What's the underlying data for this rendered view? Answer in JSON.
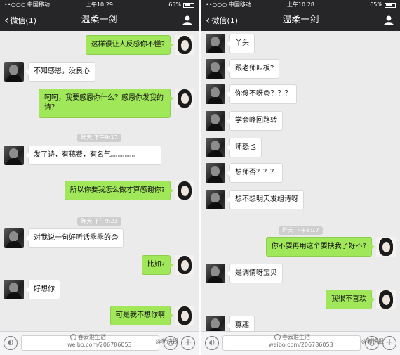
{
  "left": {
    "status": {
      "carrier": "••○○○ 中国移动",
      "time": "上午10:29",
      "battery": "65%"
    },
    "nav": {
      "back_label": "微信(1)",
      "title": "温柔一剑"
    },
    "messages": [
      {
        "dir": "out",
        "text": "这样很让人反感你不懂?"
      },
      {
        "dir": "in",
        "text": "不知感恩，没良心"
      },
      {
        "dir": "out",
        "text": "呵呵，我要感恩你什么？感恩你发我的诗？"
      },
      {
        "dir": "in",
        "text": "发了诗，有稿费，有名气。。。。。。。"
      },
      {
        "dir": "out",
        "text": "所以你要我怎么做才算感谢你?"
      },
      {
        "dir": "in",
        "text": "对我说一句好听话乖乖的😊"
      },
      {
        "dir": "out",
        "text": "比如?"
      },
      {
        "dir": "in",
        "text": "好想你"
      },
      {
        "dir": "out",
        "text": "可是我不想你啊"
      }
    ],
    "timestamps": [
      "昨天 下午9:17",
      "昨天 下午9:23"
    ],
    "watermark": {
      "line1": "春云港生活",
      "line2": "weibo.com/2067860​53",
      "brand": "@新快报"
    }
  },
  "right": {
    "status": {
      "carrier": "••○○○ 中国移动",
      "time": "上午10:28",
      "battery": "65%"
    },
    "nav": {
      "back_label": "微信(1)",
      "title": "温柔一剑"
    },
    "messages": [
      {
        "dir": "in",
        "text": "丫头"
      },
      {
        "dir": "in",
        "text": "跟老师叫板?"
      },
      {
        "dir": "in",
        "text": "你傻不呀😊？？？"
      },
      {
        "dir": "in",
        "text": "学会峰回路转"
      },
      {
        "dir": "in",
        "text": "师怒也"
      },
      {
        "dir": "in",
        "text": "想师否？？？"
      },
      {
        "dir": "in",
        "text": "想不想明天发组诗呀"
      },
      {
        "dir": "out",
        "text": "你不要再用这个要挟我了好不?"
      },
      {
        "dir": "in",
        "text": "是调情呀宝贝"
      },
      {
        "dir": "out",
        "text": "我很不喜欢"
      },
      {
        "dir": "in",
        "text": "寡趣"
      }
    ],
    "timestamps": [
      "昨天 下午8:17"
    ],
    "watermark": {
      "line1": "春云港生活",
      "line2": "weibo.com/206786053",
      "brand": "@新快报"
    }
  },
  "icons": {
    "voice": "voice-icon",
    "emoji": "emoji-icon",
    "plus": "plus-icon",
    "profile": "profile-icon",
    "back": "chevron-left-icon"
  },
  "colors": {
    "header": "#262628",
    "bubble_out": "#a0e75a",
    "bubble_in": "#ffffff",
    "chat_bg": "#ebebeb"
  }
}
